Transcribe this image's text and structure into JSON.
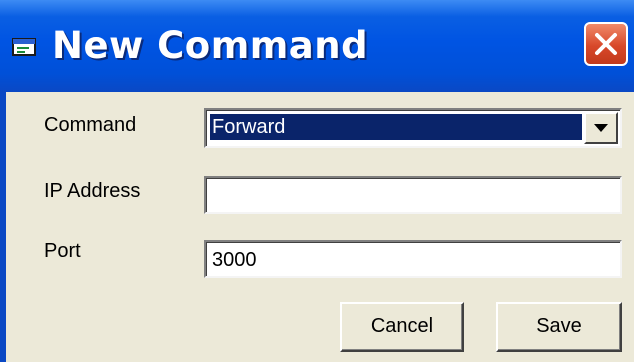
{
  "window": {
    "title": "New Command",
    "title_icon": "window-icon",
    "close_icon": "close-icon"
  },
  "form": {
    "command": {
      "label": "Command",
      "value": "Forward",
      "dropdown_icon": "chevron-down-icon"
    },
    "ip_address": {
      "label": "IP Address",
      "value": ""
    },
    "port": {
      "label": "Port",
      "value": "3000"
    }
  },
  "buttons": {
    "cancel": "Cancel",
    "save": "Save"
  },
  "colors": {
    "titlebar": "#0054e3",
    "window_bg": "#ece9d8",
    "close_button": "#d8482a",
    "selection": "#0a246a"
  }
}
